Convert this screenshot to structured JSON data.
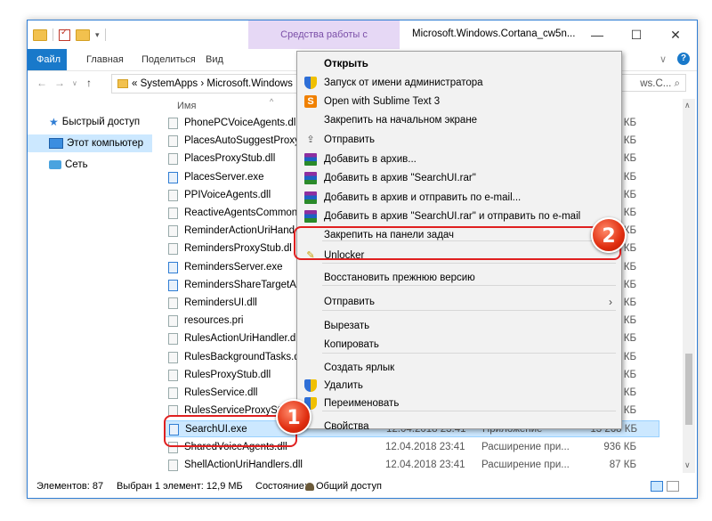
{
  "window": {
    "context_tab": "Средства работы с приложениями",
    "title": "Microsoft.Windows.Cortana_cw5n...",
    "ctrl_min": "—",
    "ctrl_max": "☐",
    "ctrl_close": "✕"
  },
  "ribbon": {
    "tabs": [
      "Файл",
      "Главная",
      "Поделиться",
      "Вид"
    ],
    "expand": "∨",
    "help": "?"
  },
  "address": {
    "path": "« SystemApps  ›  Microsoft.Windows",
    "search_text": "ws.C...  ⌕",
    "back": "←",
    "forward": "→",
    "up": "↑"
  },
  "nav_pane": {
    "items": [
      "Быстрый доступ",
      "Этот компьютер",
      "Сеть"
    ]
  },
  "file_list": {
    "column_name": "Имя",
    "rows": [
      {
        "name": "PhonePCVoiceAgents.dll",
        "date": "",
        "type": "",
        "size": "КБ",
        "kind": "dll"
      },
      {
        "name": "PlacesAutoSuggestProxy",
        "date": "",
        "type": "",
        "size": "КБ",
        "kind": "dll"
      },
      {
        "name": "PlacesProxyStub.dll",
        "date": "",
        "type": "",
        "size": "КБ",
        "kind": "dll"
      },
      {
        "name": "PlacesServer.exe",
        "date": "",
        "type": "",
        "size": "КБ",
        "kind": "exe"
      },
      {
        "name": "PPIVoiceAgents.dll",
        "date": "",
        "type": "",
        "size": "КБ",
        "kind": "dll"
      },
      {
        "name": "ReactiveAgentsCommon",
        "date": "",
        "type": "",
        "size": "КБ",
        "kind": "dll"
      },
      {
        "name": "ReminderActionUriHand",
        "date": "",
        "type": "",
        "size": "КБ",
        "kind": "dll"
      },
      {
        "name": "RemindersProxyStub.dl",
        "date": "",
        "type": "",
        "size": "КБ",
        "kind": "dll"
      },
      {
        "name": "RemindersServer.exe",
        "date": "",
        "type": "",
        "size": "КБ",
        "kind": "exe"
      },
      {
        "name": "RemindersShareTargetAp",
        "date": "",
        "type": "",
        "size": "КБ",
        "kind": "exe"
      },
      {
        "name": "RemindersUI.dll",
        "date": "",
        "type": "",
        "size": "КБ",
        "kind": "dll"
      },
      {
        "name": "resources.pri",
        "date": "",
        "type": "",
        "size": "КБ",
        "kind": "dll"
      },
      {
        "name": "RulesActionUriHandler.d",
        "date": "",
        "type": "",
        "size": "КБ",
        "kind": "dll"
      },
      {
        "name": "RulesBackgroundTasks.d",
        "date": "",
        "type": "",
        "size": "КБ",
        "kind": "dll"
      },
      {
        "name": "RulesProxyStub.dll",
        "date": "",
        "type": "",
        "size": "КБ",
        "kind": "dll"
      },
      {
        "name": "RulesService.dll",
        "date": "",
        "type": "",
        "size": "КБ",
        "kind": "dll"
      },
      {
        "name": "RulesServiceProxyStub.d",
        "date": "",
        "type": "",
        "size": "КБ",
        "kind": "dll"
      },
      {
        "name": "SearchUI.exe",
        "date": "12.04.2018 23:41",
        "type": "Приложение",
        "size": "13 268 КБ",
        "kind": "exe"
      },
      {
        "name": "SharedVoiceAgents.dll",
        "date": "12.04.2018 23:41",
        "type": "Расширение при...",
        "size": "936 КБ",
        "kind": "dll"
      },
      {
        "name": "ShellActionUriHandlers.dll",
        "date": "12.04.2018 23:41",
        "type": "Расширение при...",
        "size": "87 КБ",
        "kind": "dll"
      }
    ]
  },
  "context_menu": {
    "items": [
      {
        "label": "Открыть",
        "icon": "",
        "bold": true
      },
      {
        "label": "Запуск от имени администратора",
        "icon": "shield-icon"
      },
      {
        "label": "Open with Sublime Text 3",
        "icon": "sublime-icon"
      },
      {
        "label": "Закрепить на начальном экране",
        "icon": ""
      },
      {
        "label": "Отправить",
        "icon": "share-icon"
      },
      {
        "label": "Добавить в архив...",
        "icon": "winrar-icon"
      },
      {
        "label": "Добавить в архив \"SearchUI.rar\"",
        "icon": "winrar-icon"
      },
      {
        "label": "Добавить в архив и отправить по e-mail...",
        "icon": "winrar-icon"
      },
      {
        "label": "Добавить в архив \"SearchUI.rar\" и отправить по e-mail",
        "icon": "winrar-icon"
      },
      {
        "label": "Закрепить на панели задач",
        "icon": ""
      },
      {
        "label": "Unlocker",
        "icon": "wand-icon"
      },
      {
        "label": "Восстановить прежнюю версию",
        "icon": ""
      },
      {
        "label": "Отправить",
        "icon": "",
        "submenu": true
      },
      {
        "label": "Вырезать",
        "icon": ""
      },
      {
        "label": "Копировать",
        "icon": ""
      },
      {
        "label": "Создать ярлык",
        "icon": ""
      },
      {
        "label": "Удалить",
        "icon": "shield-icon"
      },
      {
        "label": "Переименовать",
        "icon": "shield-icon"
      },
      {
        "label": "Свойства",
        "icon": ""
      }
    ],
    "submenu_arrow": "›"
  },
  "statusbar": {
    "count": "Элементов: 87",
    "selected": "Выбран 1 элемент: 12,9 МБ",
    "state": "Состояние:",
    "share": "Общий доступ"
  },
  "badges": {
    "one": "1",
    "two": "2"
  },
  "colors": {
    "accent": "#1979ca",
    "highlight": "#e02020",
    "selection": "#cce8ff"
  }
}
